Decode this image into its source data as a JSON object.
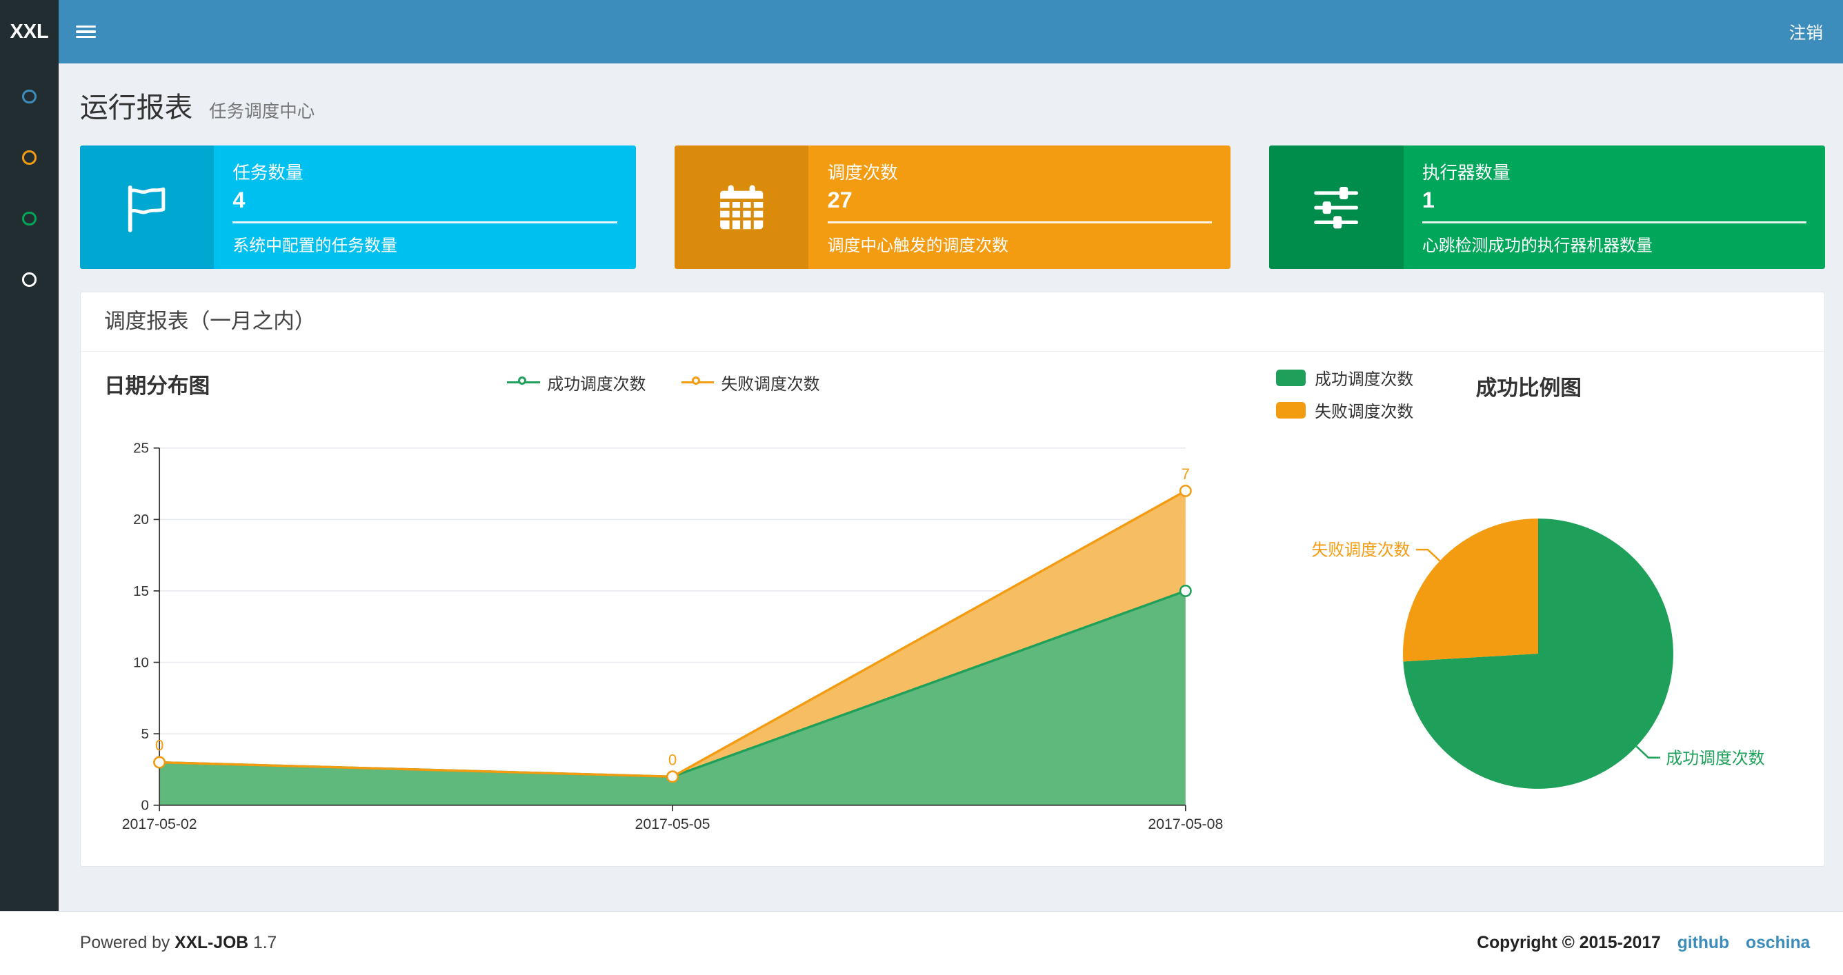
{
  "navbar": {
    "logo": "XXL",
    "logout_label": "注销"
  },
  "sidebar": {
    "items": [
      {
        "icon": "circle-icon",
        "color": "#3c8dbc"
      },
      {
        "icon": "circle-icon",
        "color": "#f39c12"
      },
      {
        "icon": "circle-icon",
        "color": "#00a65a"
      },
      {
        "icon": "circle-icon",
        "color": "#ffffff"
      }
    ]
  },
  "header": {
    "title": "运行报表",
    "subtitle": "任务调度中心"
  },
  "info_boxes": [
    {
      "title": "任务数量",
      "number": "4",
      "description": "系统中配置的任务数量",
      "color": "#00c0ef",
      "icon_color": "#00a7d0",
      "icon": "flag-icon"
    },
    {
      "title": "调度次数",
      "number": "27",
      "description": "调度中心触发的调度次数",
      "color": "#f39c12",
      "icon_color": "#db8b0b",
      "icon": "calendar-icon"
    },
    {
      "title": "执行器数量",
      "number": "1",
      "description": "心跳检测成功的执行器机器数量",
      "color": "#00a65a",
      "icon_color": "#008d4c",
      "icon": "sliders-icon"
    }
  ],
  "panel": {
    "title": "调度报表（一月之内）"
  },
  "chart_data": [
    {
      "type": "area",
      "title": "日期分布图",
      "stacked": true,
      "x": [
        "2017-05-02",
        "2017-05-05",
        "2017-05-08"
      ],
      "series": [
        {
          "name": "成功调度次数",
          "values": [
            3,
            2,
            15
          ],
          "color": "#1fa05a",
          "fill": "#5fb97c"
        },
        {
          "name": "失败调度次数",
          "values": [
            0,
            0,
            7
          ],
          "color": "#f39c12",
          "fill": "#f6bd62",
          "point_labels": true
        }
      ],
      "ylim": [
        0,
        25
      ],
      "ytick_step": 5,
      "grid": true,
      "legend_position": "top"
    },
    {
      "type": "pie",
      "title": "成功比例图",
      "slices": [
        {
          "label": "成功调度次数",
          "value": 20,
          "color": "#1fa05a"
        },
        {
          "label": "失败调度次数",
          "value": 7,
          "color": "#f39c12"
        }
      ],
      "legend_position": "top-left"
    }
  ],
  "footer": {
    "powered_by": "Powered by",
    "product": "XXL-JOB",
    "version": "1.7",
    "copyright": "Copyright © 2015-2017",
    "links": [
      "github",
      "oschina"
    ]
  },
  "colors": {
    "navbar": "#3c8dbc",
    "sidebar": "#222d32",
    "background": "#ecf0f5",
    "aqua": "#00c0ef",
    "yellow": "#f39c12",
    "green": "#00a65a",
    "link": "#3c8dbc"
  }
}
